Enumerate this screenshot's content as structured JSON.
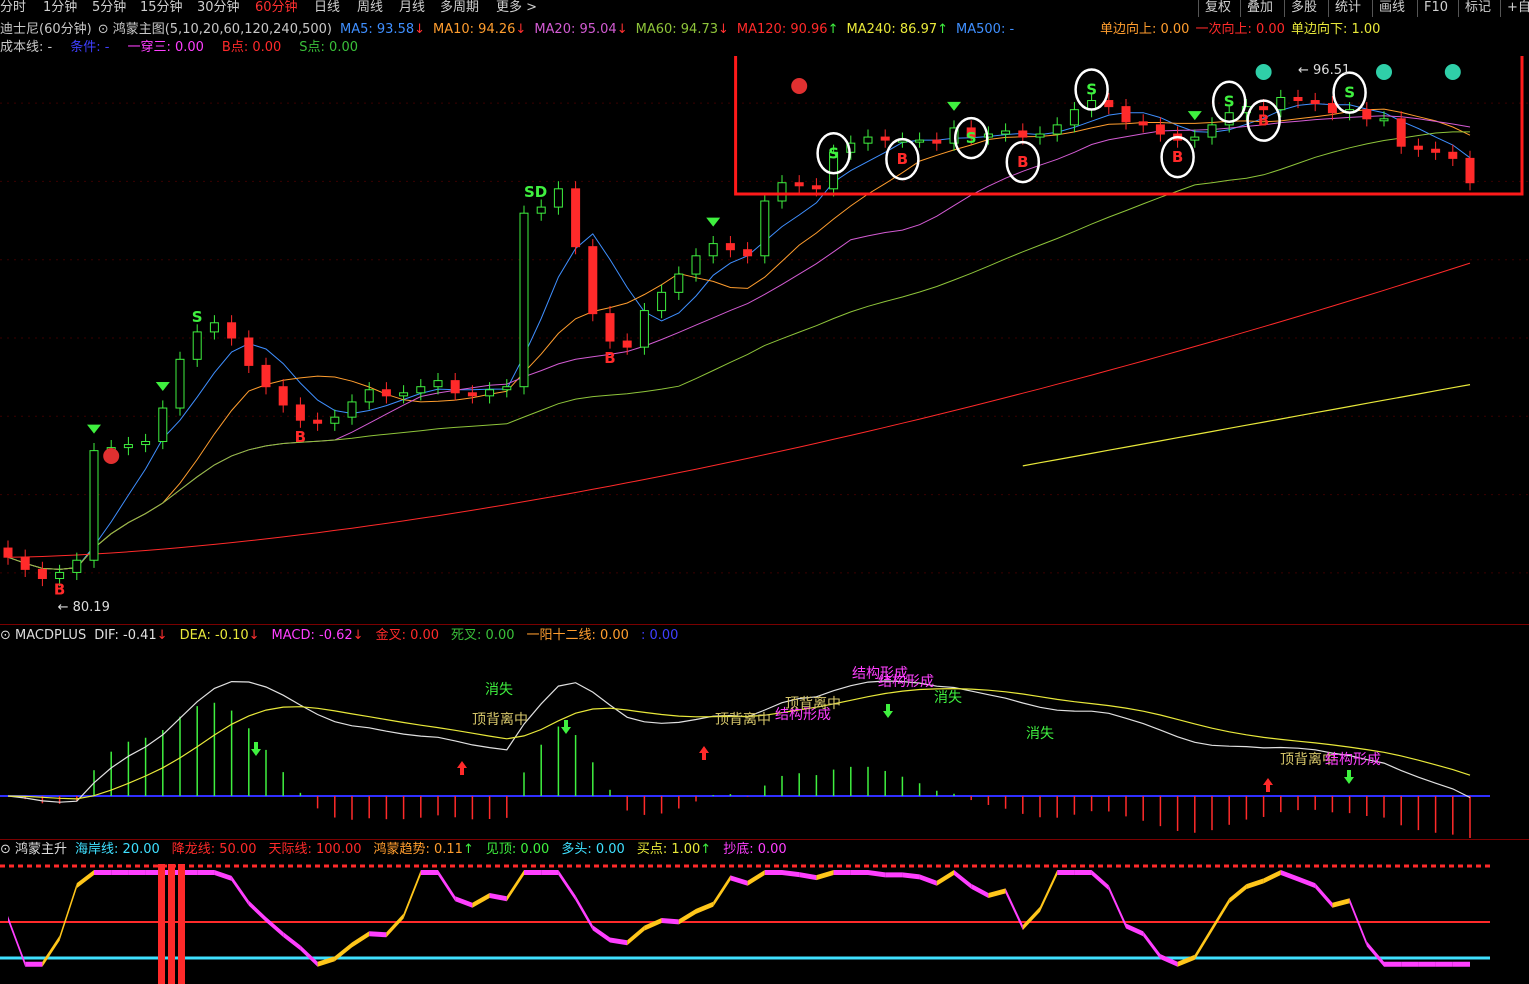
{
  "tabs": [
    "分时",
    "1分钟",
    "5分钟",
    "15分钟",
    "30分钟",
    "60分钟",
    "日线",
    "周线",
    "月线",
    "多周期",
    "更多 >"
  ],
  "active_tab": "60分钟",
  "right_buttons": [
    "复权",
    "叠加",
    "多股",
    "统计",
    "画线",
    "F10",
    "标记",
    "+自"
  ],
  "main_header": {
    "stock": "迪士尼(60分钟)",
    "indicator": "鸿蒙主图(5,10,20,60,120,240,500)",
    "ma": [
      {
        "label": "MA5: 93.58",
        "arrow": "↓",
        "color": "#3f8fff"
      },
      {
        "label": "MA10: 94.26",
        "arrow": "↓",
        "color": "#ff9d2e"
      },
      {
        "label": "MA20: 95.04",
        "arrow": "↓",
        "color": "#d35bd3"
      },
      {
        "label": "MA60: 94.73",
        "arrow": "↓",
        "color": "#8ec43a"
      },
      {
        "label": "MA120: 90.96",
        "arrow": "↑",
        "color": "#ff2a2a"
      },
      {
        "label": "MA240: 86.97",
        "arrow": "↑",
        "color": "#e8e83a"
      },
      {
        "label": "MA500: -",
        "arrow": "",
        "color": "#3f8fff"
      }
    ],
    "right_signals": [
      {
        "label": "单边向上: 0.00",
        "color": "#ff9d2e"
      },
      {
        "label": "一次向上: 0.00",
        "color": "#ff2a2a"
      },
      {
        "label": "单边向下: 1.00",
        "color": "#e8e83a"
      }
    ],
    "row2": [
      {
        "label": "成本线: -",
        "color": "#c8c8c8"
      },
      {
        "label": "条件: -",
        "color": "#3f3fff"
      },
      {
        "label": "一穿三: 0.00",
        "color": "#ff3fff"
      },
      {
        "label": "B点: 0.00",
        "color": "#ff2a2a"
      },
      {
        "label": "S点: 0.00",
        "color": "#3ac03a"
      }
    ]
  },
  "annotations": {
    "high": "96.51",
    "low": "80.19",
    "sd": "SD",
    "b": "B",
    "s": "S"
  },
  "macd_header": {
    "name": "MACDPLUS",
    "items": [
      {
        "label": "DIF: -0.41",
        "arrow": "↓",
        "color": "#e0e0e0"
      },
      {
        "label": "DEA: -0.10",
        "arrow": "↓",
        "color": "#e8e83a"
      },
      {
        "label": "MACD: -0.62",
        "arrow": "↓",
        "color": "#ff3fff"
      },
      {
        "label": "金叉: 0.00",
        "arrow": "",
        "color": "#ff2a2a"
      },
      {
        "label": "死叉: 0.00",
        "arrow": "",
        "color": "#3ac03a"
      },
      {
        "label": "一阳十二线: 0.00",
        "arrow": "",
        "color": "#ff9d2e"
      },
      {
        "label": ": 0.00",
        "arrow": "",
        "color": "#3f3fff"
      }
    ]
  },
  "macd_texts": [
    {
      "text": "消失",
      "color": "#3ff03f"
    },
    {
      "text": "顶背离中",
      "color": "#d6c66a"
    },
    {
      "text": "顶背离中",
      "color": "#d6c66a"
    },
    {
      "text": "结构形成",
      "color": "#ff3fff"
    },
    {
      "text": "顶背离中",
      "color": "#d6c66a"
    },
    {
      "text": "结构形成",
      "color": "#ff3fff"
    },
    {
      "text": "结构形成",
      "color": "#ff3fff"
    },
    {
      "text": "消失",
      "color": "#3ff03f"
    },
    {
      "text": "消失",
      "color": "#3ff03f"
    },
    {
      "text": "顶背离中",
      "color": "#d6c66a"
    },
    {
      "text": "结构形成",
      "color": "#ff3fff"
    }
  ],
  "hm_header": {
    "name": "鸿蒙主升",
    "items": [
      {
        "label": "海岸线: 20.00",
        "arrow": "",
        "color": "#3fe0ff"
      },
      {
        "label": "降龙线: 50.00",
        "arrow": "",
        "color": "#ff2a2a"
      },
      {
        "label": "天际线: 100.00",
        "arrow": "",
        "color": "#ff2a2a"
      },
      {
        "label": "鸿蒙趋势: 0.11",
        "arrow": "↑",
        "color": "#ff9d2e"
      },
      {
        "label": "见顶: 0.00",
        "arrow": "",
        "color": "#3ff03f"
      },
      {
        "label": "多头: 0.00",
        "arrow": "",
        "color": "#3fe0ff"
      },
      {
        "label": "买点: 1.00",
        "arrow": "↑",
        "color": "#e8e83a"
      },
      {
        "label": "抄底: 0.00",
        "arrow": "",
        "color": "#ff3fff"
      }
    ]
  },
  "chart_data": {
    "type": "candlestick",
    "title": "迪士尼(60分钟)",
    "price_annotations": {
      "high": 96.51,
      "low": 80.19
    },
    "ylim": [
      79.5,
      97.5
    ],
    "close": [
      81.3,
      80.9,
      80.6,
      80.8,
      81.2,
      84.8,
      84.9,
      85.0,
      85.1,
      86.2,
      87.8,
      88.7,
      89.0,
      88.5,
      87.6,
      86.9,
      86.3,
      85.8,
      85.7,
      85.9,
      86.4,
      86.8,
      86.6,
      86.7,
      86.9,
      87.1,
      86.7,
      86.6,
      86.8,
      86.9,
      92.6,
      92.8,
      93.4,
      91.5,
      89.3,
      88.4,
      88.2,
      89.4,
      90.0,
      90.6,
      91.2,
      91.6,
      91.4,
      91.2,
      93.0,
      93.6,
      93.5,
      93.4,
      94.6,
      94.9,
      95.1,
      95.0,
      95.0,
      95.0,
      94.9,
      95.4,
      95.1,
      95.2,
      95.3,
      95.1,
      95.2,
      95.5,
      96.0,
      96.3,
      96.1,
      95.6,
      95.5,
      95.2,
      95.0,
      95.1,
      95.5,
      95.9,
      96.1,
      96.0,
      96.4,
      96.3,
      96.2,
      95.9,
      96.0,
      95.7,
      95.7,
      94.8,
      94.7,
      94.6,
      94.4,
      93.6
    ],
    "ma_values": {
      "MA5": 93.58,
      "MA10": 94.26,
      "MA20": 95.04,
      "MA60": 94.73,
      "MA120": 90.96,
      "MA240": 86.97
    }
  }
}
